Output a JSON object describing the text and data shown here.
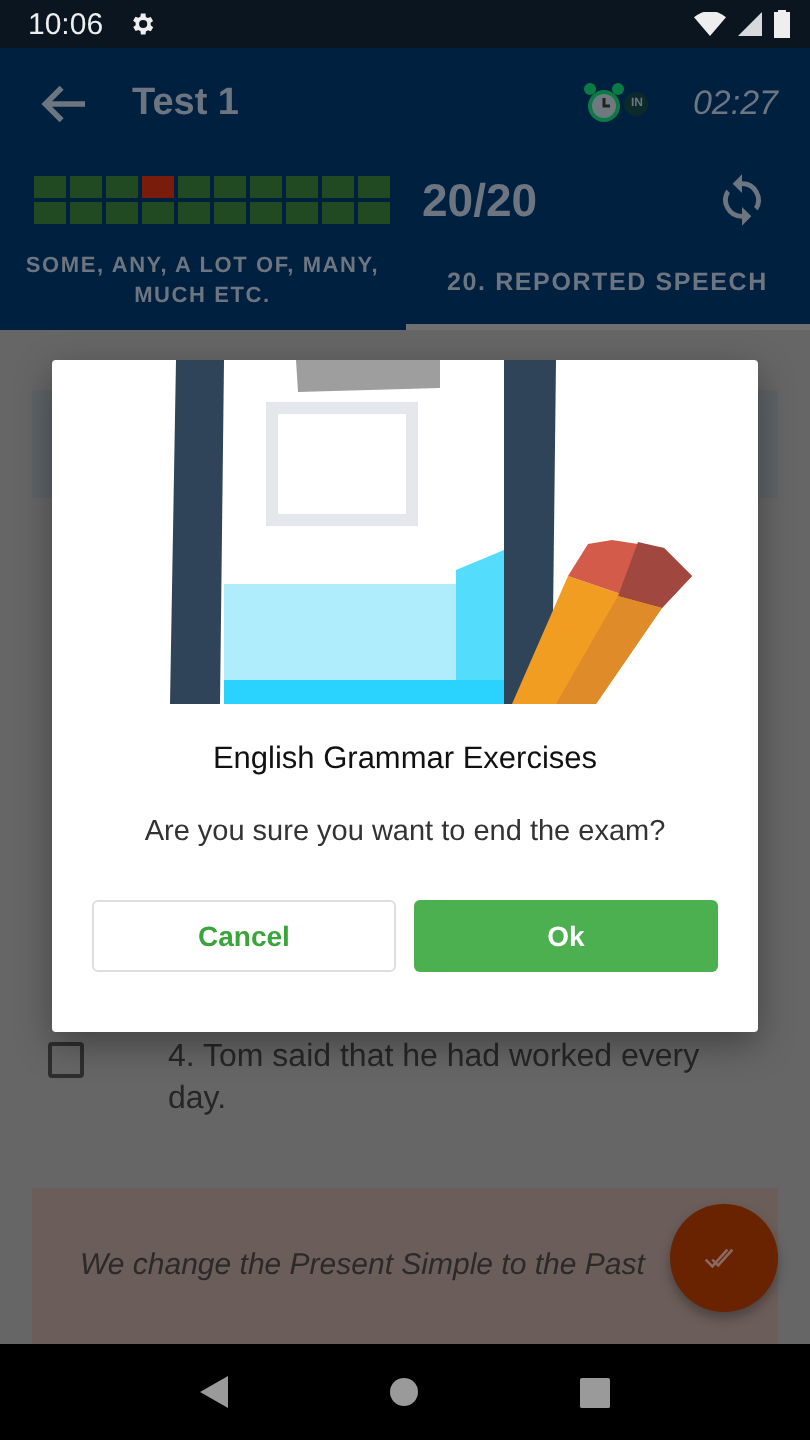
{
  "status_bar": {
    "time": "10:06"
  },
  "toolbar": {
    "title": "Test 1",
    "timer_badge": "IN",
    "time_left": "02:27"
  },
  "progress": {
    "cells": [
      {
        "correct": true
      },
      {
        "correct": true
      },
      {
        "correct": true
      },
      {
        "correct": false
      },
      {
        "correct": true
      },
      {
        "correct": true
      },
      {
        "correct": true
      },
      {
        "correct": true
      },
      {
        "correct": true
      },
      {
        "correct": true
      },
      {
        "correct": true
      },
      {
        "correct": true
      },
      {
        "correct": true
      },
      {
        "correct": true
      },
      {
        "correct": true
      },
      {
        "correct": true
      },
      {
        "correct": true
      },
      {
        "correct": true
      },
      {
        "correct": true
      },
      {
        "correct": true
      }
    ],
    "score": "20/20"
  },
  "tabs": [
    {
      "label": "SOME, ANY, A LOT OF, MANY, MUCH ETC.",
      "selected": false
    },
    {
      "label": "20. REPORTED SPEECH",
      "selected": true
    }
  ],
  "question": {
    "text": "4. Tom said that he had worked every day.",
    "checked": false
  },
  "hint": {
    "text": "We change the Present Simple to the Past"
  },
  "dialog": {
    "title": "English Grammar Exercises",
    "message": "Are you sure you want to end the exam?",
    "buttons": [
      {
        "label": "Cancel",
        "kind": "outline"
      },
      {
        "label": "Ok",
        "kind": "filled"
      }
    ]
  }
}
